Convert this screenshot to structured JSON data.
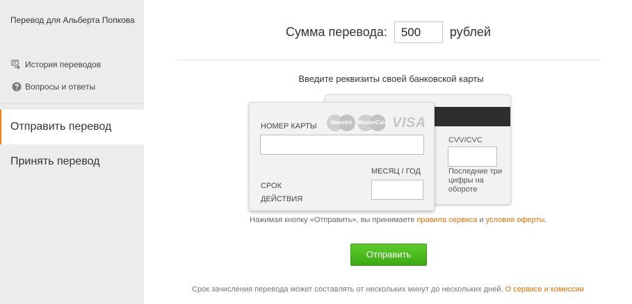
{
  "sidebar": {
    "title": "Перевод для Альберта Попкова",
    "history_label": "История переводов",
    "faq_label": "Вопросы и ответы",
    "tabs": [
      {
        "label": "Отправить перевод"
      },
      {
        "label": "Принять перевод"
      }
    ]
  },
  "amount": {
    "label": "Сумма перевода:",
    "value": "500",
    "currency": "рублей"
  },
  "card": {
    "hint": "Введите реквизиты своей банковской карты",
    "number_label": "НОМЕР КАРТЫ",
    "expiry_label": "СРОК ДЕЙСТВИЯ",
    "month_year_label": "МЕСЯЦ / ГОД",
    "cvv_label": "CVV/CVC",
    "cvv_hint": "Последние три цифры на обороте",
    "logos": {
      "maestro": "Maestro",
      "mastercard": "MasterCard",
      "visa": "VISA"
    }
  },
  "terms": {
    "prefix": "Нажимая кнопку «Отправить», вы принимаете ",
    "rules_link": "правила сервиса",
    "and": " и ",
    "offer_link": "условия оферты",
    "suffix": "."
  },
  "submit_label": "Отправить",
  "footer": {
    "text": "Срок зачисления перевода может составлять от нескольких минут до нескольких дней. ",
    "link": "О сервисе и комиссии"
  },
  "colors": {
    "accent": "#ee8208",
    "link": "#e0700a",
    "button": "#4cb81f"
  }
}
